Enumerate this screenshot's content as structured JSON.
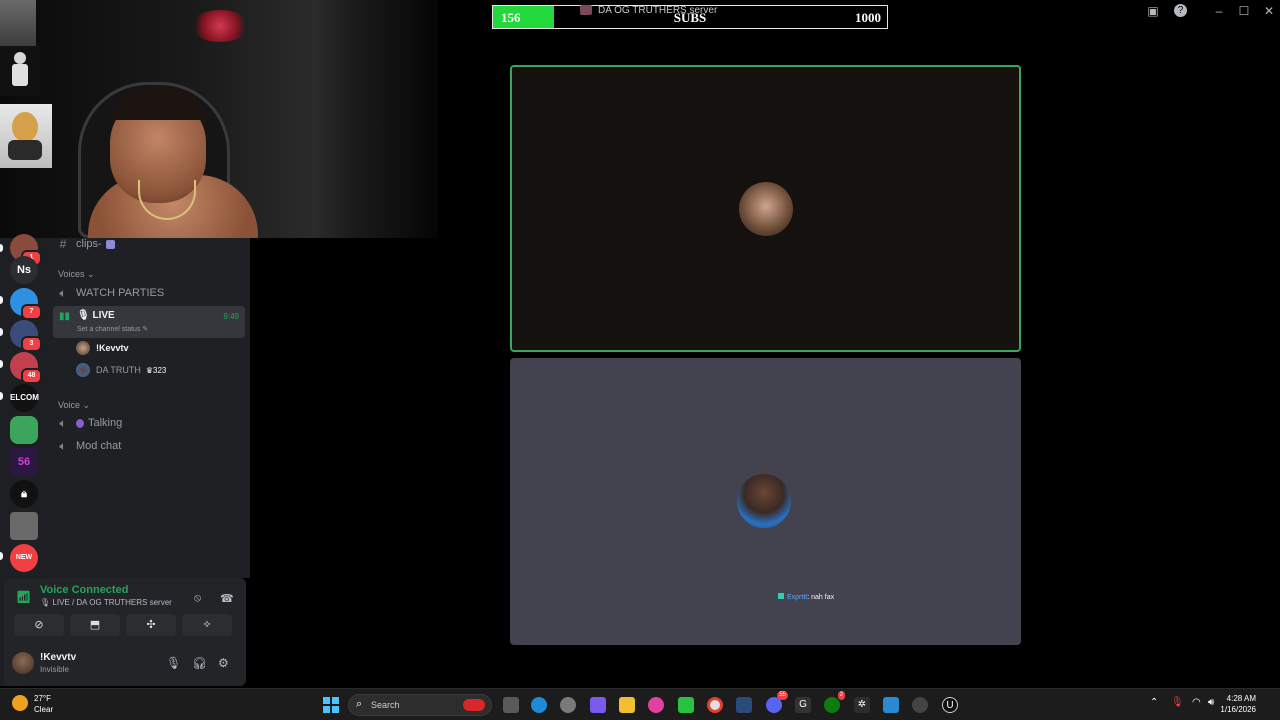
{
  "titlebar": {
    "inbox_icon": "inbox-icon",
    "help_icon": "help-icon",
    "minimize": "–",
    "maximize": "☐",
    "close": "✕"
  },
  "subs_goal": {
    "current": "156",
    "label": "SUBS",
    "goal": "1000",
    "progress_fraction": 0.156,
    "fill_color": "#22d83a"
  },
  "server_overlay_text": "DA OG TRUTHERS server",
  "rail": {
    "servers": [
      {
        "label": "",
        "badge": "1",
        "color": "#8a4a3c"
      },
      {
        "label": "Ns",
        "badge": "",
        "color": "#2b2d31"
      },
      {
        "label": "",
        "badge": "7",
        "color": "#2f8fe0"
      },
      {
        "label": "",
        "badge": "3",
        "color": "#3a4c7a"
      },
      {
        "label": "",
        "badge": "48",
        "color": "#c04050"
      },
      {
        "label": "ELCOM",
        "badge": "",
        "color": "#111111"
      },
      {
        "label": "",
        "badge": "",
        "color": "#3ba55d"
      },
      {
        "label": "56",
        "badge": "",
        "color": "#2a1840"
      },
      {
        "label": "",
        "badge": "",
        "color": "#111111"
      },
      {
        "label": "",
        "badge": "",
        "color": "#6a6a6a"
      },
      {
        "label": "NEW",
        "badge": "",
        "color": "#f23f43"
      }
    ]
  },
  "channels": {
    "clips": "clips-",
    "voices_category": "Voices",
    "watch_parties": "WATCH PARTIES",
    "live": {
      "name": "LIVE",
      "status": "Set a channel status",
      "time": "9:49"
    },
    "members": [
      {
        "name": "!Kevvtv",
        "extra": ""
      },
      {
        "name": "DA TRUTH",
        "extra": "323"
      }
    ],
    "voice_category": "Voice",
    "talking": "Talking",
    "mod_chat": "Mod chat"
  },
  "voice_panel": {
    "title": "Voice Connected",
    "subtitle": "LIVE / DA OG TRUTHERS server"
  },
  "user_panel": {
    "name": "!Kevvtv",
    "status": "Invisible"
  },
  "tile_chat": {
    "user": "Exprttt",
    "message": ": nah fax"
  },
  "taskbar": {
    "weather_temp": "27°F",
    "weather_cond": "Clear",
    "search_placeholder": "Search",
    "time": "4:28 AM",
    "date": "1/16/2026",
    "app_badge_discord": "55",
    "app_badge_xbox": "2"
  }
}
